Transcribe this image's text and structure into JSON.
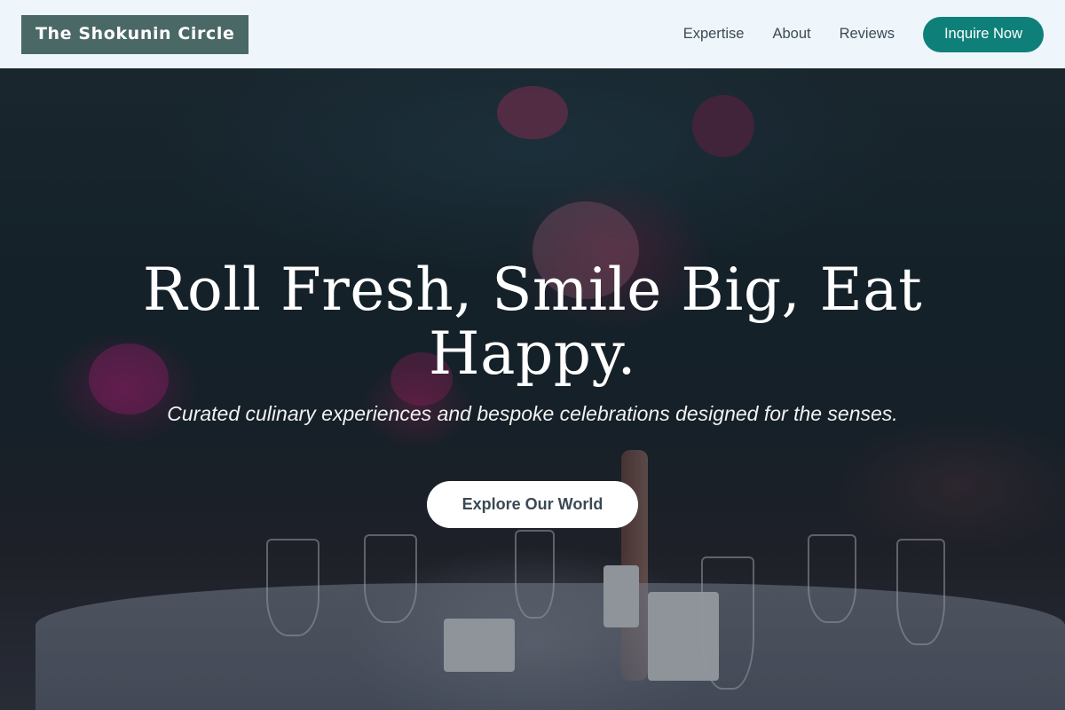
{
  "nav": {
    "brand": "The Shokunin Circle",
    "links": [
      "Expertise",
      "About",
      "Reviews"
    ],
    "cta_label": "Inquire Now"
  },
  "hero": {
    "title": "Roll Fresh, Smile Big, Eat Happy.",
    "subtitle": "Curated culinary experiences and bespoke celebrations designed for the senses.",
    "button_label": "Explore Our World"
  },
  "colors": {
    "nav_background": "#eef6fb",
    "brand_background": "#4a6866",
    "accent": "#0f8079",
    "hero_button_background": "#ffffff"
  }
}
